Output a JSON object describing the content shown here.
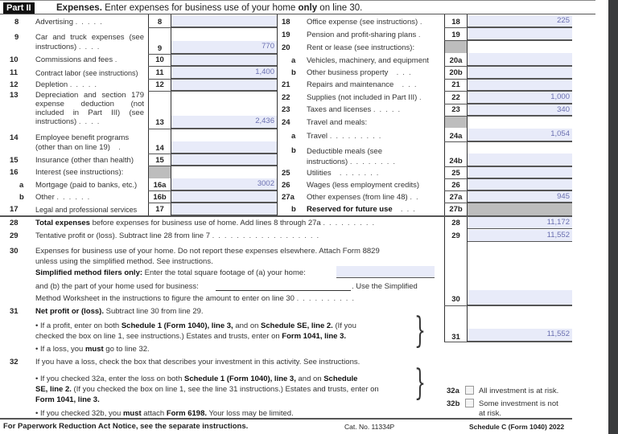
{
  "header": {
    "part_label": "Part II",
    "title_bold": "Expenses.",
    "title_text": " Enter expenses for business use of your home ",
    "title_only": "only",
    "title_end": " on line 30."
  },
  "left_lines": [
    {
      "num": "8",
      "label": "Advertising",
      "box": "8",
      "value": ""
    },
    {
      "num": "9",
      "label": "Car and truck expenses (see instructions)",
      "box": "9",
      "value": "770"
    },
    {
      "num": "10",
      "label": "Commissions and fees",
      "box": "10",
      "value": ""
    },
    {
      "num": "11",
      "label": "Contract labor (see instructions)",
      "box": "11",
      "value": "1,400"
    },
    {
      "num": "12",
      "label": "Depletion",
      "box": "12",
      "value": ""
    },
    {
      "num": "13",
      "label": "Depreciation and section 179 expense deduction (not included in Part III) (see instructions)",
      "box": "13",
      "value": "2,436"
    },
    {
      "num": "14",
      "label": "Employee benefit programs (other than on line 19)",
      "box": "14",
      "value": ""
    },
    {
      "num": "15",
      "label": "Insurance (other than health)",
      "box": "15",
      "value": ""
    },
    {
      "num": "16",
      "label": "Interest (see instructions):",
      "box": "",
      "value": ""
    },
    {
      "num": "a",
      "label": "Mortgage (paid to banks, etc.)",
      "box": "16a",
      "value": "3002"
    },
    {
      "num": "b",
      "label": "Other",
      "box": "16b",
      "value": ""
    },
    {
      "num": "17",
      "label": "Legal and professional services",
      "box": "17",
      "value": ""
    }
  ],
  "right_lines": [
    {
      "num": "18",
      "label": "Office expense (see instructions)",
      "box": "18",
      "value": "225"
    },
    {
      "num": "19",
      "label": "Pension and profit-sharing plans",
      "box": "19",
      "value": ""
    },
    {
      "num": "20",
      "label": "Rent or lease (see instructions):",
      "box": "",
      "value": ""
    },
    {
      "num": "a",
      "label": "Vehicles, machinery, and equipment",
      "box": "20a",
      "value": ""
    },
    {
      "num": "b",
      "label": "Other business property",
      "box": "20b",
      "value": ""
    },
    {
      "num": "21",
      "label": "Repairs and maintenance",
      "box": "21",
      "value": ""
    },
    {
      "num": "22",
      "label": "Supplies (not included in Part III)",
      "box": "22",
      "value": "1,000"
    },
    {
      "num": "23",
      "label": "Taxes and licenses",
      "box": "23",
      "value": "340"
    },
    {
      "num": "24",
      "label": "Travel and meals:",
      "box": "",
      "value": ""
    },
    {
      "num": "a",
      "label": "Travel",
      "box": "24a",
      "value": "1,054"
    },
    {
      "num": "b",
      "label": "Deductible meals (see instructions)",
      "box": "24b",
      "value": ""
    },
    {
      "num": "25",
      "label": "Utilities",
      "box": "25",
      "value": ""
    },
    {
      "num": "26",
      "label": "Wages (less employment credits)",
      "box": "26",
      "value": ""
    },
    {
      "num": "27a",
      "label": "Other expenses (from line 48)",
      "box": "27a",
      "value": "945"
    },
    {
      "num": "b",
      "label": "Reserved for future use",
      "box": "27b",
      "value": ""
    }
  ],
  "line28": {
    "num": "28",
    "label_bold": "Total expenses",
    "label": " before expenses for business use of home. Add lines 8 through 27a",
    "box": "28",
    "value": "11,172"
  },
  "line29": {
    "num": "29",
    "label": "Tentative profit or (loss). Subtract line 28 from line 7",
    "box": "29",
    "value": "11,552"
  },
  "line30": {
    "num": "30",
    "text1": "Expenses for business use of your home. Do not report these expenses elsewhere. Attach Form 8829",
    "text2": "unless using the simplified method. See instructions.",
    "simplified_bold": "Simplified method filers only:",
    "simplified_text": " Enter the total square footage of (a) your home:",
    "home_sqft": "",
    "part_b_text": "and (b) the part of your home used for business:",
    "business_sqft": "",
    "use_simplified": ". Use the Simplified",
    "worksheet_text": "Method Worksheet in the instructions to figure the amount to enter on line 30",
    "box": "30",
    "value": ""
  },
  "line31": {
    "num": "31",
    "title_bold": "Net profit or (loss).",
    "title_text": " Subtract line 30 from line 29.",
    "bullet1_a": "• If a profit, enter on both ",
    "bullet1_b": "Schedule 1 (Form 1040), line 3,",
    "bullet1_c": " and on ",
    "bullet1_d": "Schedule SE, line 2.",
    "bullet1_e": " (If you",
    "bullet1_f": "checked the box on line 1, see instructions.) Estates and trusts, enter on ",
    "bullet1_g": "Form 1041, line 3.",
    "bullet2_a": "• If a loss, you ",
    "bullet2_b": "must",
    "bullet2_c": "  go to line 32.",
    "box": "31",
    "value": "11,552"
  },
  "line32": {
    "num": "32",
    "text": "If you have a loss, check the box that describes your investment in this activity. See instructions.",
    "bullet1_a": "• If you checked 32a, enter the loss on both ",
    "bullet1_b": "Schedule 1 (Form 1040), line 3,",
    "bullet1_c": " and on ",
    "bullet1_d": "Schedule",
    "bullet1_e": "SE, line 2.",
    "bullet1_f": " (If you checked the box on line 1, see the line 31 instructions.) Estates and trusts, enter on",
    "bullet1_g": "Form 1041, line 3.",
    "bullet2_a": "• If you checked 32b, you ",
    "bullet2_b": "must",
    "bullet2_c": " attach ",
    "bullet2_d": "Form 6198.",
    "bullet2_e": " Your loss may be limited.",
    "opt_a_code": "32a",
    "opt_a_label": "All investment is at risk.",
    "opt_a_checked": false,
    "opt_b_code": "32b",
    "opt_b_label": "Some investment is not",
    "opt_b_label2": "at risk.",
    "opt_b_checked": false
  },
  "footer": {
    "notice": "For Paperwork Reduction Act Notice, see the separate instructions.",
    "cat_no": "Cat. No. 11334P",
    "form_name": "Schedule C (Form 1040) 2022"
  }
}
